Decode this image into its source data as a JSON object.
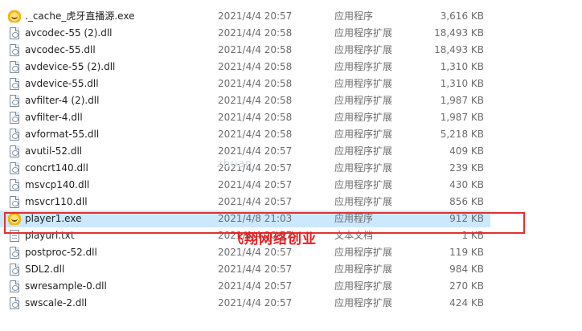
{
  "files": [
    {
      "name": "._cache_虎牙直播源.exe",
      "date": "2021/4/4 20:57",
      "type": "应用程序",
      "size": "3,616 KB",
      "icon": "app-icon"
    },
    {
      "name": "avcodec-55 (2).dll",
      "date": "2021/4/4 20:58",
      "type": "应用程序扩展",
      "size": "18,493 KB",
      "icon": "dll-file-icon"
    },
    {
      "name": "avcodec-55.dll",
      "date": "2021/4/4 20:58",
      "type": "应用程序扩展",
      "size": "18,493 KB",
      "icon": "dll-file-icon"
    },
    {
      "name": "avdevice-55 (2).dll",
      "date": "2021/4/4 20:58",
      "type": "应用程序扩展",
      "size": "1,310 KB",
      "icon": "dll-file-icon"
    },
    {
      "name": "avdevice-55.dll",
      "date": "2021/4/4 20:58",
      "type": "应用程序扩展",
      "size": "1,310 KB",
      "icon": "dll-file-icon"
    },
    {
      "name": "avfilter-4 (2).dll",
      "date": "2021/4/4 20:58",
      "type": "应用程序扩展",
      "size": "1,987 KB",
      "icon": "dll-file-icon"
    },
    {
      "name": "avfilter-4.dll",
      "date": "2021/4/4 20:58",
      "type": "应用程序扩展",
      "size": "1,987 KB",
      "icon": "dll-file-icon"
    },
    {
      "name": "avformat-55.dll",
      "date": "2021/4/4 20:58",
      "type": "应用程序扩展",
      "size": "5,218 KB",
      "icon": "dll-file-icon"
    },
    {
      "name": "avutil-52.dll",
      "date": "2021/4/4 20:57",
      "type": "应用程序扩展",
      "size": "409 KB",
      "icon": "dll-file-icon"
    },
    {
      "name": "concrt140.dll",
      "date": "2021/4/4 20:57",
      "type": "应用程序扩展",
      "size": "239 KB",
      "icon": "dll-file-icon"
    },
    {
      "name": "msvcp140.dll",
      "date": "2021/4/4 20:57",
      "type": "应用程序扩展",
      "size": "430 KB",
      "icon": "dll-file-icon"
    },
    {
      "name": "msvcr110.dll",
      "date": "2021/4/4 20:57",
      "type": "应用程序扩展",
      "size": "856 KB",
      "icon": "dll-file-icon"
    },
    {
      "name": "player1.exe",
      "date": "2021/4/8 21:03",
      "type": "应用程序",
      "size": "912 KB",
      "icon": "app-icon",
      "selected": true
    },
    {
      "name": "playurl.txt",
      "date": "2021/4/4 20:57",
      "type": "文本文档",
      "size": "1 KB",
      "icon": "text-file-icon"
    },
    {
      "name": "postproc-52.dll",
      "date": "2021/4/4 20:57",
      "type": "应用程序扩展",
      "size": "119 KB",
      "icon": "dll-file-icon"
    },
    {
      "name": "SDL2.dll",
      "date": "2021/4/4 20:57",
      "type": "应用程序扩展",
      "size": "984 KB",
      "icon": "dll-file-icon"
    },
    {
      "name": "swresample-0.dll",
      "date": "2021/4/4 20:57",
      "type": "应用程序扩展",
      "size": "270 KB",
      "icon": "dll-file-icon"
    },
    {
      "name": "swscale-2.dll",
      "date": "2021/4/4 20:57",
      "type": "应用程序扩展",
      "size": "424 KB",
      "icon": "dll-file-icon"
    }
  ],
  "overlay": {
    "caption": "飞翔网络创业",
    "watermark": "zhuan"
  },
  "colors": {
    "selection": "#cce8ff",
    "highlight_border": "#e0312f",
    "caption": "#e81e1e"
  }
}
